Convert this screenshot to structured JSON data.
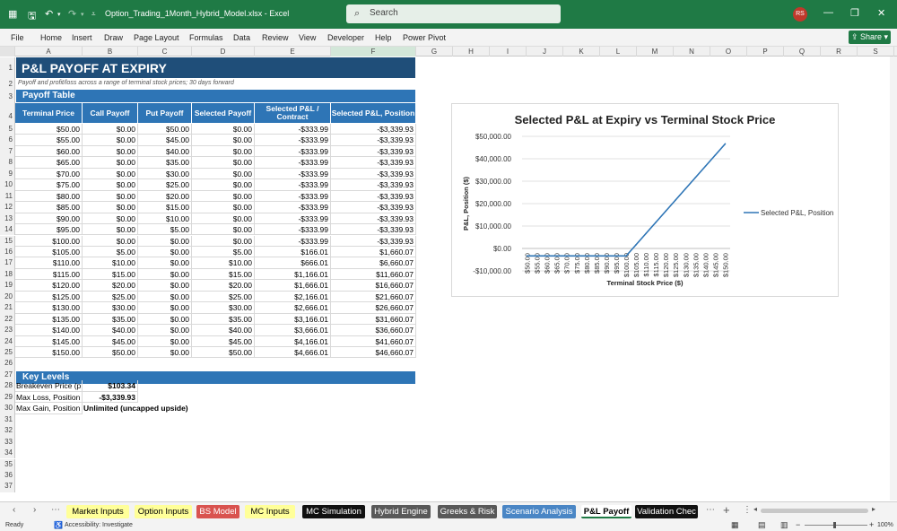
{
  "window": {
    "title": "Option_Trading_1Month_Hybrid_Model.xlsx  -  Excel",
    "search_placeholder": "Search",
    "avatar": "RS"
  },
  "menu": [
    "File",
    "Home",
    "Insert",
    "Draw",
    "Page Layout",
    "Formulas",
    "Data",
    "Review",
    "View",
    "Developer",
    "Help",
    "Power Pivot"
  ],
  "share_label": "Share",
  "columns": [
    "A",
    "B",
    "C",
    "D",
    "E",
    "F",
    "G",
    "H",
    "I",
    "J",
    "K",
    "L",
    "M",
    "N",
    "O",
    "P",
    "Q",
    "R",
    "S"
  ],
  "rows": [
    "1",
    "2",
    "3",
    "4",
    "5",
    "6",
    "7",
    "8",
    "9",
    "10",
    "11",
    "12",
    "13",
    "14",
    "15",
    "16",
    "17",
    "18",
    "19",
    "20",
    "21",
    "22",
    "23",
    "24",
    "25",
    "26",
    "27",
    "28",
    "29",
    "30",
    "31",
    "32",
    "33",
    "34",
    "35",
    "36",
    "37"
  ],
  "sheet": {
    "title": "P&L PAYOFF AT EXPIRY",
    "subtitle": "Payoff and profit/loss across a range of terminal stock prices; 30 days forward",
    "payoff_section": "Payoff Table",
    "headers": [
      "Terminal Price",
      "Call Payoff",
      "Put Payoff",
      "Selected Payoff",
      "Selected P&L / Contract",
      "Selected P&L, Position"
    ],
    "table": [
      [
        "$50.00",
        "$0.00",
        "$50.00",
        "$0.00",
        "-$333.99",
        "-$3,339.93"
      ],
      [
        "$55.00",
        "$0.00",
        "$45.00",
        "$0.00",
        "-$333.99",
        "-$3,339.93"
      ],
      [
        "$60.00",
        "$0.00",
        "$40.00",
        "$0.00",
        "-$333.99",
        "-$3,339.93"
      ],
      [
        "$65.00",
        "$0.00",
        "$35.00",
        "$0.00",
        "-$333.99",
        "-$3,339.93"
      ],
      [
        "$70.00",
        "$0.00",
        "$30.00",
        "$0.00",
        "-$333.99",
        "-$3,339.93"
      ],
      [
        "$75.00",
        "$0.00",
        "$25.00",
        "$0.00",
        "-$333.99",
        "-$3,339.93"
      ],
      [
        "$80.00",
        "$0.00",
        "$20.00",
        "$0.00",
        "-$333.99",
        "-$3,339.93"
      ],
      [
        "$85.00",
        "$0.00",
        "$15.00",
        "$0.00",
        "-$333.99",
        "-$3,339.93"
      ],
      [
        "$90.00",
        "$0.00",
        "$10.00",
        "$0.00",
        "-$333.99",
        "-$3,339.93"
      ],
      [
        "$95.00",
        "$0.00",
        "$5.00",
        "$0.00",
        "-$333.99",
        "-$3,339.93"
      ],
      [
        "$100.00",
        "$0.00",
        "$0.00",
        "$0.00",
        "-$333.99",
        "-$3,339.93"
      ],
      [
        "$105.00",
        "$5.00",
        "$0.00",
        "$5.00",
        "$166.01",
        "$1,660.07"
      ],
      [
        "$110.00",
        "$10.00",
        "$0.00",
        "$10.00",
        "$666.01",
        "$6,660.07"
      ],
      [
        "$115.00",
        "$15.00",
        "$0.00",
        "$15.00",
        "$1,166.01",
        "$11,660.07"
      ],
      [
        "$120.00",
        "$20.00",
        "$0.00",
        "$20.00",
        "$1,666.01",
        "$16,660.07"
      ],
      [
        "$125.00",
        "$25.00",
        "$0.00",
        "$25.00",
        "$2,166.01",
        "$21,660.07"
      ],
      [
        "$130.00",
        "$30.00",
        "$0.00",
        "$30.00",
        "$2,666.01",
        "$26,660.07"
      ],
      [
        "$135.00",
        "$35.00",
        "$0.00",
        "$35.00",
        "$3,166.01",
        "$31,660.07"
      ],
      [
        "$140.00",
        "$40.00",
        "$0.00",
        "$40.00",
        "$3,666.01",
        "$36,660.07"
      ],
      [
        "$145.00",
        "$45.00",
        "$0.00",
        "$45.00",
        "$4,166.01",
        "$41,660.07"
      ],
      [
        "$150.00",
        "$50.00",
        "$0.00",
        "$50.00",
        "$4,666.01",
        "$46,660.07"
      ]
    ],
    "key_levels_title": "Key Levels",
    "key_levels": [
      {
        "label": "Breakeven Price (p",
        "value": "$103.34"
      },
      {
        "label": "Max Loss, Position",
        "value": "-$3,339.93"
      },
      {
        "label": "Max Gain, Position",
        "value": "Unlimited (uncapped upside)"
      }
    ]
  },
  "chart_data": {
    "type": "line",
    "title": "Selected P&L at Expiry vs Terminal Stock Price",
    "xlabel": "Terminal Stock Price ($)",
    "ylabel": "P&L, Position ($)",
    "ylim": [
      -10000,
      50000
    ],
    "yticks": [
      "$50,000.00",
      "$40,000.00",
      "$30,000.00",
      "$20,000.00",
      "$10,000.00",
      "$0.00",
      "-$10,000.00"
    ],
    "ytick_values": [
      50000,
      40000,
      30000,
      20000,
      10000,
      0,
      -10000
    ],
    "categories": [
      "$50.00",
      "$55.00",
      "$60.00",
      "$65.00",
      "$70.00",
      "$75.00",
      "$80.00",
      "$85.00",
      "$90.00",
      "$95.00",
      "$100.00",
      "$105.00",
      "$110.00",
      "$115.00",
      "$120.00",
      "$125.00",
      "$130.00",
      "$135.00",
      "$140.00",
      "$145.00",
      "$150.00"
    ],
    "series": [
      {
        "name": "Selected P&L, Position",
        "values": [
          -3339.93,
          -3339.93,
          -3339.93,
          -3339.93,
          -3339.93,
          -3339.93,
          -3339.93,
          -3339.93,
          -3339.93,
          -3339.93,
          -3339.93,
          1660.07,
          6660.07,
          11660.07,
          16660.07,
          21660.07,
          26660.07,
          31660.07,
          36660.07,
          41660.07,
          46660.07
        ],
        "color": "#2e75b6"
      }
    ],
    "legend": "right",
    "grid": true
  },
  "tabs": [
    {
      "label": "Market Inputs",
      "bg": "#ffff99",
      "fg": "#000000"
    },
    {
      "label": "Option Inputs",
      "bg": "#ffff99",
      "fg": "#000000"
    },
    {
      "label": "BS Model",
      "bg": "#d9534f",
      "fg": "#ffffff"
    },
    {
      "label": "MC Inputs",
      "bg": "#ffff99",
      "fg": "#000000"
    },
    {
      "label": "MC Simulation",
      "bg": "#111111",
      "fg": "#ffffff"
    },
    {
      "label": "Hybrid Engine",
      "bg": "#595959",
      "fg": "#ffffff"
    },
    {
      "label": "Greeks & Risk",
      "bg": "#595959",
      "fg": "#ffffff"
    },
    {
      "label": "Scenario Analysis",
      "bg": "#4a86c5",
      "fg": "#ffffff"
    },
    {
      "label": "P&L Payoff",
      "bg": "#ffffff",
      "fg": "#000000"
    },
    {
      "label": "Validation Chec",
      "bg": "#111111",
      "fg": "#ffffff"
    }
  ],
  "status": {
    "ready": "Ready",
    "accessibility": "Accessibility: Investigate",
    "zoom": "100%"
  }
}
